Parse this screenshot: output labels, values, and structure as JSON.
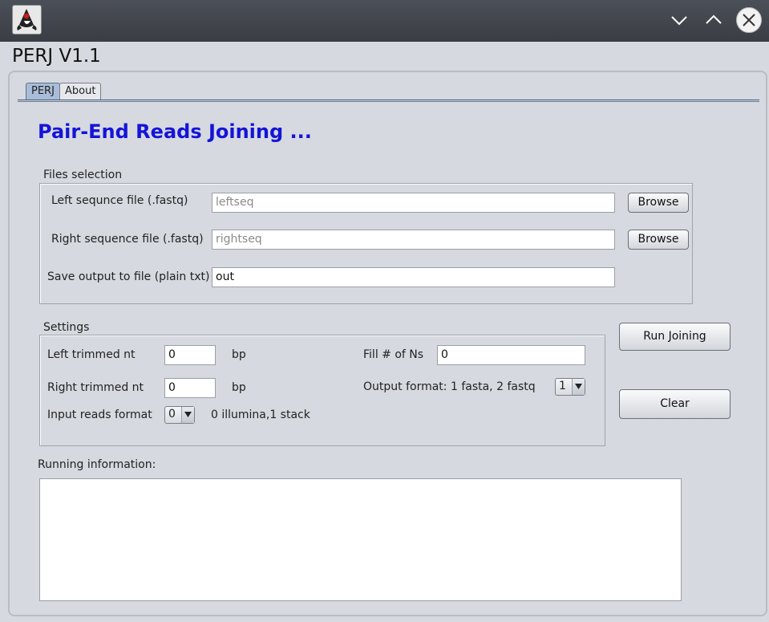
{
  "window": {
    "app_icon": "java-duke-icon",
    "controls": [
      "minimize-icon",
      "maximize-icon",
      "close-icon"
    ]
  },
  "app_title": "PERJ V1.1",
  "tabs": [
    {
      "label": "PERJ",
      "active": true
    },
    {
      "label": "About",
      "active": false
    }
  ],
  "heading": "Pair-End Reads Joining ...",
  "files": {
    "group_label": "Files selection",
    "left_label": "Left sequnce file (.fastq)",
    "left_placeholder": "leftseq",
    "right_label": "Right sequence file (.fastq)",
    "right_placeholder": "rightseq",
    "output_label": "Save output to file (plain txt)",
    "output_value": "out",
    "browse_label": "Browse"
  },
  "settings": {
    "group_label": "Settings",
    "left_trim_label": "Left trimmed nt",
    "left_trim_value": "0",
    "right_trim_label": "Right trimmed nt",
    "right_trim_value": "0",
    "bp_unit": "bp",
    "input_format_label": "Input reads format",
    "input_format_value": "0",
    "input_format_hint": "0 illumina,1 stack",
    "fill_ns_label": "Fill # of Ns",
    "fill_ns_value": "0",
    "output_format_label": "Output format: 1 fasta, 2 fastq",
    "output_format_value": "1"
  },
  "actions": {
    "run_label": "Run Joining",
    "clear_label": "Clear"
  },
  "running": {
    "label": "Running information:",
    "content": ""
  },
  "colors": {
    "heading": "#1414d8",
    "titlebar": "#3f434a",
    "active_tab": "#a9bdd8"
  }
}
